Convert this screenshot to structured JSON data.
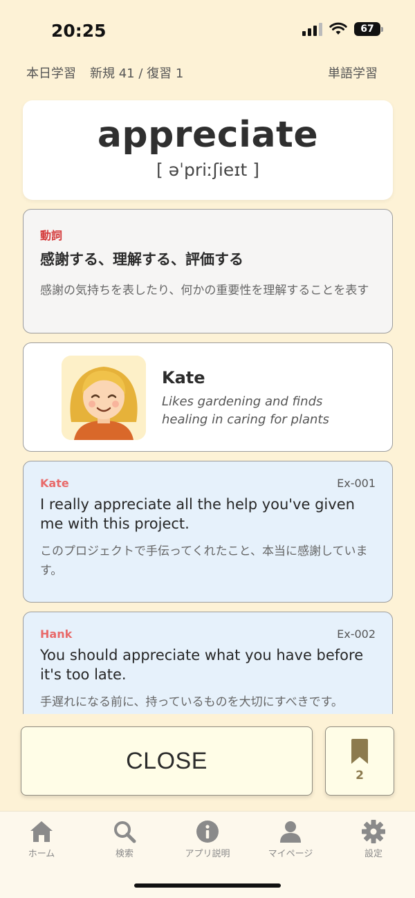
{
  "status_bar": {
    "time": "20:25",
    "battery": "67"
  },
  "header": {
    "today_label": "本日学習",
    "counts": "新規 41 / 復習 1",
    "mode": "単語学習"
  },
  "word": {
    "text": "appreciate",
    "ipa": "[ əˈpriːʃieɪt ]"
  },
  "meaning": {
    "part_of_speech": "動詞",
    "translation": "感謝する、理解する、評価する",
    "description": "感謝の気持ちを表したり、何かの重要性を理解することを表す"
  },
  "character": {
    "name": "Kate",
    "description": "Likes gardening and finds healing in caring for plants"
  },
  "examples": [
    {
      "speaker": "Kate",
      "id": "Ex-001",
      "english": "I really appreciate all the help you've given me with this project.",
      "japanese": "このプロジェクトで手伝ってくれたこと、本当に感謝しています。"
    },
    {
      "speaker": "Hank",
      "id": "Ex-002",
      "english": "You should appreciate what you have before it's too late.",
      "japanese": "手遅れになる前に、持っているものを大切にすべきです。"
    }
  ],
  "actions": {
    "close_label": "CLOSE",
    "bookmark_count": "2"
  },
  "tabs": [
    {
      "label": "ホーム",
      "icon": "home-icon"
    },
    {
      "label": "検索",
      "icon": "search-icon"
    },
    {
      "label": "アプリ説明",
      "icon": "info-icon"
    },
    {
      "label": "マイページ",
      "icon": "person-icon"
    },
    {
      "label": "設定",
      "icon": "gear-icon"
    }
  ],
  "colors": {
    "background": "#fdf2d6",
    "pos_red": "#d43a3a",
    "speaker_red": "#e86a6a",
    "example_bg": "#e6f1fb",
    "bookmark_brown": "#8c7a4e"
  }
}
